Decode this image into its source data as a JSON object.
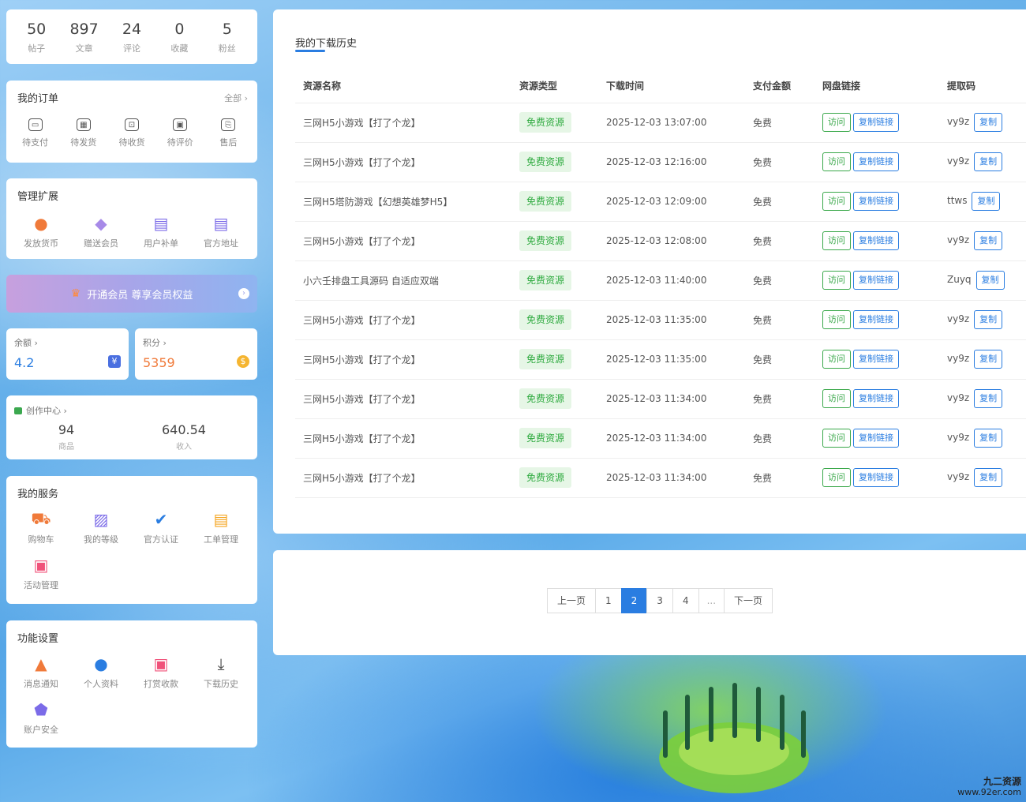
{
  "stats": [
    {
      "num": "50",
      "label": "帖子"
    },
    {
      "num": "897",
      "label": "文章"
    },
    {
      "num": "24",
      "label": "评论"
    },
    {
      "num": "0",
      "label": "收藏"
    },
    {
      "num": "5",
      "label": "粉丝"
    }
  ],
  "orders": {
    "title": "我的订单",
    "more": "全部 ›",
    "items": [
      {
        "label": "待支付",
        "icon": "wallet-icon"
      },
      {
        "label": "待发货",
        "icon": "package-icon"
      },
      {
        "label": "待收货",
        "icon": "delivery-icon"
      },
      {
        "label": "待评价",
        "icon": "comment-icon"
      },
      {
        "label": "售后",
        "icon": "refund-icon"
      }
    ]
  },
  "manage": {
    "title": "管理扩展",
    "items": [
      {
        "label": "发放货币",
        "icon": "coin-bag-icon",
        "color": "#f07a3a"
      },
      {
        "label": "赠送会员",
        "icon": "diamond-icon",
        "color": "#a78ae8"
      },
      {
        "label": "用户补单",
        "icon": "document-icon",
        "color": "#7b6be8"
      },
      {
        "label": "官方地址",
        "icon": "document-icon",
        "color": "#7b6be8"
      }
    ]
  },
  "vip": {
    "label": "开通会员  尊享会员权益",
    "icon": "crown-icon"
  },
  "balance": {
    "title": "余额 ›",
    "value": "4.2",
    "color": "#2a7de1",
    "icon": "yuan-icon"
  },
  "points": {
    "title": "积分 ›",
    "value": "5359",
    "color": "#f07a3a",
    "icon": "coins-icon"
  },
  "creator": {
    "title": "创作中心 ›",
    "stats": [
      {
        "num": "94",
        "label": "商品"
      },
      {
        "num": "640.54",
        "label": "收入"
      }
    ]
  },
  "services": {
    "title": "我的服务",
    "items": [
      {
        "label": "购物车",
        "icon": "cart-icon",
        "color": "#f07a3a"
      },
      {
        "label": "我的等级",
        "icon": "chart-icon",
        "color": "#7b6be8"
      },
      {
        "label": "官方认证",
        "icon": "verified-icon",
        "color": "#2a7de1"
      },
      {
        "label": "工单管理",
        "icon": "ticket-icon",
        "color": "#f5a623"
      },
      {
        "label": "活动管理",
        "icon": "gift-icon",
        "color": "#f0527a"
      }
    ]
  },
  "settings": {
    "title": "功能设置",
    "items": [
      {
        "label": "消息通知",
        "icon": "bell-icon",
        "color": "#f07a3a"
      },
      {
        "label": "个人资料",
        "icon": "user-icon",
        "color": "#2a7de1"
      },
      {
        "label": "打赏收款",
        "icon": "gift-icon",
        "color": "#f0527a"
      },
      {
        "label": "下载历史",
        "icon": "download-icon",
        "color": "#444"
      },
      {
        "label": "账户安全",
        "icon": "shield-icon",
        "color": "#7b6be8"
      }
    ]
  },
  "history": {
    "heading": "我的下载历史",
    "columns": [
      "资源名称",
      "资源类型",
      "下载时间",
      "支付金额",
      "网盘链接",
      "提取码"
    ],
    "visit_label": "访问",
    "copy_link_label": "复制链接",
    "copy_label": "复制",
    "rows": [
      {
        "name": "三网H5小游戏【打了个龙】",
        "type": "免费资源",
        "time": "2025-12-03 13:07:00",
        "amount": "免费",
        "code": "vy9z"
      },
      {
        "name": "三网H5小游戏【打了个龙】",
        "type": "免费资源",
        "time": "2025-12-03 12:16:00",
        "amount": "免费",
        "code": "vy9z"
      },
      {
        "name": "三网H5塔防游戏【幻想英雄梦H5】",
        "type": "免费资源",
        "time": "2025-12-03 12:09:00",
        "amount": "免费",
        "code": "ttws"
      },
      {
        "name": "三网H5小游戏【打了个龙】",
        "type": "免费资源",
        "time": "2025-12-03 12:08:00",
        "amount": "免费",
        "code": "vy9z"
      },
      {
        "name": "小六壬排盘工具源码 自适应双端",
        "type": "免费资源",
        "time": "2025-12-03 11:40:00",
        "amount": "免费",
        "code": "Zuyq"
      },
      {
        "name": "三网H5小游戏【打了个龙】",
        "type": "免费资源",
        "time": "2025-12-03 11:35:00",
        "amount": "免费",
        "code": "vy9z"
      },
      {
        "name": "三网H5小游戏【打了个龙】",
        "type": "免费资源",
        "time": "2025-12-03 11:35:00",
        "amount": "免费",
        "code": "vy9z"
      },
      {
        "name": "三网H5小游戏【打了个龙】",
        "type": "免费资源",
        "time": "2025-12-03 11:34:00",
        "amount": "免费",
        "code": "vy9z"
      },
      {
        "name": "三网H5小游戏【打了个龙】",
        "type": "免费资源",
        "time": "2025-12-03 11:34:00",
        "amount": "免费",
        "code": "vy9z"
      },
      {
        "name": "三网H5小游戏【打了个龙】",
        "type": "免费资源",
        "time": "2025-12-03 11:34:00",
        "amount": "免费",
        "code": "vy9z"
      }
    ]
  },
  "pagination": {
    "prev": "上一页",
    "pages": [
      "1",
      "2",
      "3",
      "4"
    ],
    "current": "2",
    "ellipsis": "...",
    "next": "下一页"
  },
  "watermark": {
    "title": "九二资源",
    "url": "www.92er.com"
  }
}
